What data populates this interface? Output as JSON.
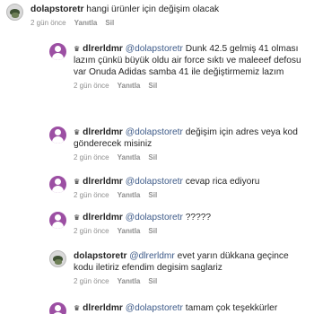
{
  "comments": [
    {
      "username": "dolapstoretr",
      "crown": "",
      "mention": "",
      "text": "hangi ürünler için değişim olacak",
      "time": "2 gün önce",
      "reply": "Yanıtla",
      "delete": "Sil",
      "avatar": "store-avatar"
    },
    {
      "username": "dlrerldmr",
      "crown": "♛",
      "mention": "@dolapstoretr",
      "text": "Dunk 42.5 gelmiş 41 olması lazım çünkü büyük oldu air force sıktı ve maleeef defosu var Onuda Adidas samba 41 ile değiştirmemiz lazım",
      "time": "2 gün önce",
      "reply": "Yanıtla",
      "delete": "Sil",
      "avatar": "user-avatar"
    },
    {
      "username": "dlrerldmr",
      "crown": "♛",
      "mention": "@dolapstoretr",
      "text": "değişim için adres veya kod gönderecek misiniz",
      "time": "2 gün önce",
      "reply": "Yanıtla",
      "delete": "Sil",
      "avatar": "user-avatar"
    },
    {
      "username": "dlrerldmr",
      "crown": "♛",
      "mention": "@dolapstoretr",
      "text": "cevap rica ediyoru",
      "time": "2 gün önce",
      "reply": "Yanıtla",
      "delete": "Sil",
      "avatar": "user-avatar"
    },
    {
      "username": "dlrerldmr",
      "crown": "♛",
      "mention": "@dolapstoretr",
      "text": "?????",
      "time": "2 gün önce",
      "reply": "Yanıtla",
      "delete": "Sil",
      "avatar": "user-avatar"
    },
    {
      "username": "dolapstoretr",
      "crown": "",
      "mention": "@dlrerldmr",
      "text": "evet yarın dükkana geçince kodu iletiriz efendim degisim saglariz",
      "time": "2 gün önce",
      "reply": "Yanıtla",
      "delete": "Sil",
      "avatar": "store-avatar"
    },
    {
      "username": "dlrerldmr",
      "crown": "♛",
      "mention": "@dolapstoretr",
      "text": "tamam çok teşekkürler",
      "time": "",
      "reply": "",
      "delete": "",
      "avatar": "user-avatar"
    }
  ]
}
